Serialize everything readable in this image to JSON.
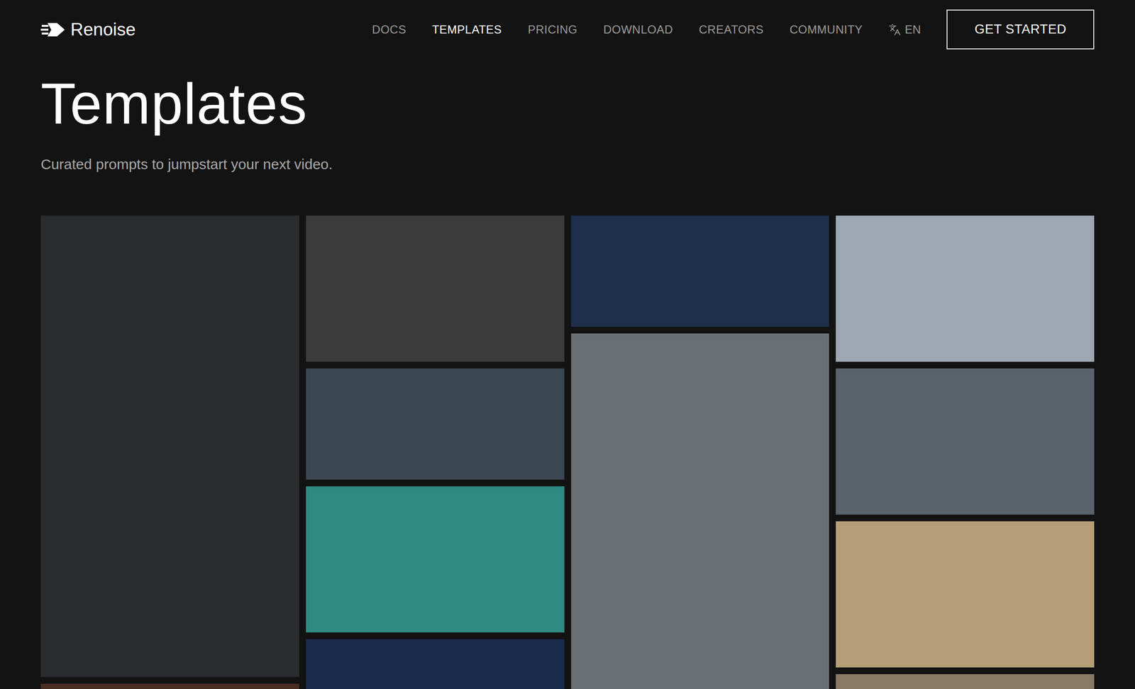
{
  "header": {
    "logo": "Renoise",
    "nav": [
      {
        "label": "DOCS",
        "selected": false
      },
      {
        "label": "TEMPLATES",
        "selected": true
      },
      {
        "label": "PRICING",
        "selected": false
      },
      {
        "label": "DOWNLOAD",
        "selected": false
      },
      {
        "label": "CREATORS",
        "selected": false
      },
      {
        "label": "COMMUNITY",
        "selected": false
      }
    ],
    "language": "EN",
    "cta": "GET STARTED"
  },
  "page": {
    "title": "Templates",
    "subtitle": "Curated prompts to jumpstart your next video."
  },
  "gallery": {
    "columns": [
      {
        "tiles": [
          {
            "kind": "tall",
            "color": "#2a2c30"
          },
          {
            "kind": "wide",
            "color": "#4a2e22"
          }
        ]
      },
      {
        "tiles": [
          {
            "kind": "wide",
            "color": "#3a3b3a"
          },
          {
            "kind": "short",
            "color": "#3a4652"
          },
          {
            "kind": "wide",
            "color": "#2f8a82"
          },
          {
            "kind": "wide",
            "color": "#1b2b4c"
          }
        ]
      },
      {
        "tiles": [
          {
            "kind": "short",
            "color": "#1e2f4a"
          },
          {
            "kind": "tall",
            "color": "#6a6f75"
          }
        ]
      },
      {
        "tiles": [
          {
            "kind": "wide",
            "color": "#9ea6b2"
          },
          {
            "kind": "wide",
            "color": "#5a636c"
          },
          {
            "kind": "wide",
            "color": "#b59e78"
          },
          {
            "kind": "wide",
            "color": "#8a7a64"
          }
        ]
      }
    ]
  }
}
